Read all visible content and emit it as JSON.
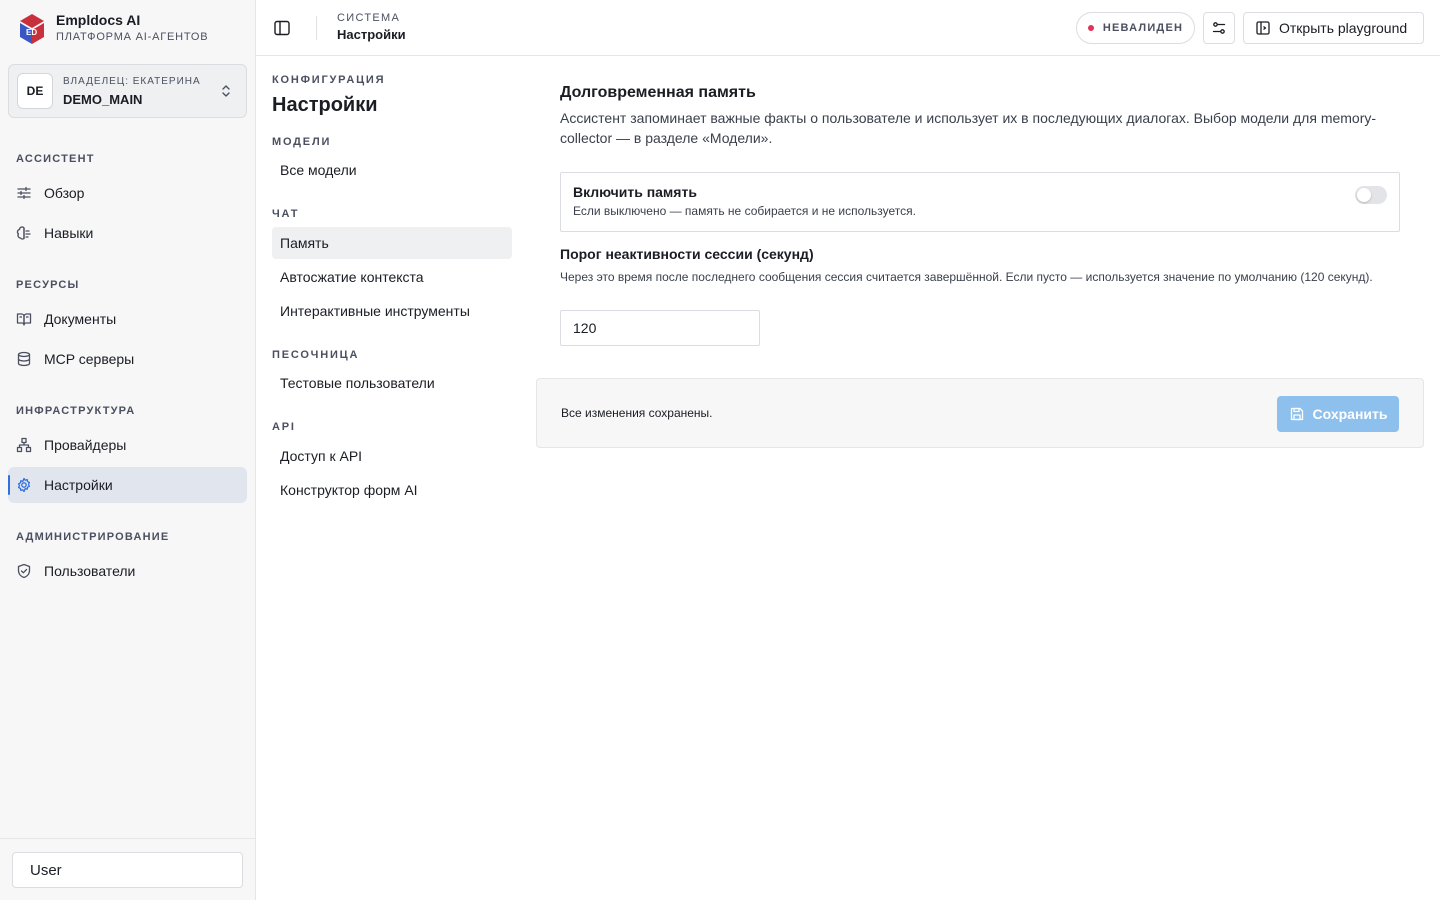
{
  "brand": {
    "name": "Empldocs AI",
    "subtitle": "ПЛАТФОРМА AI-АГЕНТОВ",
    "logo_text": "ED",
    "colors": {
      "red": "#c8313c",
      "blue": "#3a56c4"
    }
  },
  "owner": {
    "initials": "DE",
    "label": "ВЛАДЕЛЕЦ: ЕКАТЕРИНА",
    "value": "DEMO_MAIN"
  },
  "sidebar": {
    "sections": [
      {
        "label": "АССИСТЕНТ",
        "items": [
          {
            "label": "Обзор",
            "icon": "sliders-icon"
          },
          {
            "label": "Навыки",
            "icon": "brain-icon"
          }
        ]
      },
      {
        "label": "РЕСУРСЫ",
        "items": [
          {
            "label": "Документы",
            "icon": "book-icon"
          },
          {
            "label": "MCP серверы",
            "icon": "database-icon"
          }
        ]
      },
      {
        "label": "ИНФРАСТРУКТУРА",
        "items": [
          {
            "label": "Провайдеры",
            "icon": "network-icon"
          },
          {
            "label": "Настройки",
            "icon": "gear-icon",
            "active": true
          }
        ]
      },
      {
        "label": "АДМИНИСТРИРОВАНИЕ",
        "items": [
          {
            "label": "Пользователи",
            "icon": "shield-icon"
          }
        ]
      }
    ],
    "user_button": "User",
    "accent": "#2f6fe0"
  },
  "topbar": {
    "section": "СИСТЕМА",
    "page": "Настройки",
    "status": {
      "label": "НЕВАЛИДЕН",
      "color": "#e0335a"
    },
    "playground_button": "Открыть playground"
  },
  "subnav": {
    "eyebrow": "КОНФИГУРАЦИЯ",
    "title": "Настройки",
    "groups": [
      {
        "label": "МОДЕЛИ",
        "items": [
          "Все модели"
        ]
      },
      {
        "label": "ЧАТ",
        "items": [
          "Память",
          "Автосжатие контекста",
          "Интерактивные инструменты"
        ]
      },
      {
        "label": "ПЕСОЧНИЦА",
        "items": [
          "Тестовые пользователи"
        ]
      },
      {
        "label": "API",
        "items": [
          "Доступ к API",
          "Конструктор форм AI"
        ]
      }
    ],
    "active_item": "Память"
  },
  "memory": {
    "title": "Долговременная память",
    "description": "Ассистент запоминает важные факты о пользователе и использует их в последующих диалогах. Выбор модели для memory-collector — в разделе «Модели».",
    "toggle": {
      "title": "Включить память",
      "hint": "Если выключено — память не собирается и не используется.",
      "enabled": false
    },
    "threshold": {
      "label": "Порог неактивности сессии (секунд)",
      "help": "Через это время после последнего сообщения сессия считается завершённой. Если пусто — используется значение по умолчанию (120 секунд).",
      "value": "120"
    }
  },
  "save_bar": {
    "status": "Все изменения сохранены.",
    "button": "Сохранить",
    "button_color": "#8ec0ee"
  }
}
